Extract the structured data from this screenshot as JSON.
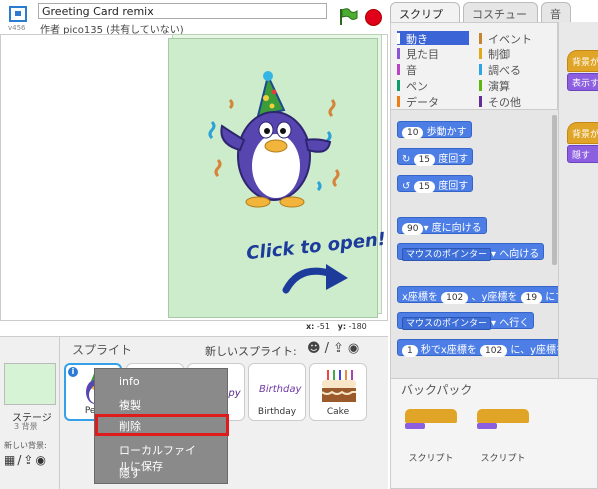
{
  "header": {
    "project_title": "Greeting Card remix",
    "author_line": "作者 pico135 (共有していない)",
    "version": "v456"
  },
  "stage": {
    "card_text": "Click to open!",
    "mouse_x_label": "x:",
    "mouse_x": "-51",
    "mouse_y_label": "y:",
    "mouse_y": "-180"
  },
  "tabs": [
    "スクリプト",
    "コスチューム",
    "音"
  ],
  "categories": {
    "left": [
      {
        "label": "動き",
        "color": "#4a6cd4",
        "selected": true
      },
      {
        "label": "見た目",
        "color": "#8a55d7"
      },
      {
        "label": "音",
        "color": "#bb42c3"
      },
      {
        "label": "ペン",
        "color": "#0e9a6c"
      },
      {
        "label": "データ",
        "color": "#ee7d16"
      }
    ],
    "right": [
      {
        "label": "イベント",
        "color": "#c88330"
      },
      {
        "label": "制御",
        "color": "#e1a91a"
      },
      {
        "label": "調べる",
        "color": "#2ca5e2"
      },
      {
        "label": "演算",
        "color": "#5cb712"
      },
      {
        "label": "その他",
        "color": "#632d99"
      }
    ]
  },
  "blocks": {
    "move_val": "10",
    "move_text": "歩動かす",
    "turn_r_val": "15",
    "turn_r_text": "度回す",
    "turn_l_val": "15",
    "turn_l_text": "度回す",
    "point_val": "90",
    "point_text": "度に向ける",
    "toward_dd": "マウスのポインター",
    "toward_text": "へ向ける",
    "goto_x_text": "x座標を",
    "goto_x_val": "102",
    "goto_y_text": "、y座標を",
    "goto_y_val": "19",
    "goto_end": "にする",
    "goto_dd": "マウスのポインター",
    "goto_text": "へ行く",
    "glide_val": "1",
    "glide_text": "秒でx座標を",
    "glide_x": "102",
    "glide_end": "に、y座標を"
  },
  "scripts": {
    "hat1": "背景が",
    "look1": "表示す",
    "hat2": "背景が",
    "look2": "隠す"
  },
  "sprites": {
    "header": "スプライト",
    "new_sprite_label": "新しいスプライト:",
    "stage_label": "ステージ",
    "stage_sub": "3 背景",
    "new_bg_label": "新しい背景:",
    "tiles": [
      {
        "name": "Pen"
      },
      {
        "name": ""
      },
      {
        "name": ""
      },
      {
        "name": "Birthday",
        "thumb_text": "Birthday"
      },
      {
        "name": "Cake"
      }
    ],
    "happy_text": "ppy"
  },
  "context_menu": {
    "items": [
      "info",
      "複製",
      "削除",
      "ローカルファイルに保存",
      "隠す"
    ]
  },
  "backpack": {
    "title": "バックパック",
    "items": [
      "スクリプト",
      "スクリプト"
    ]
  },
  "colors": {
    "motion": "#4c7ee6",
    "events": "#e0a426",
    "looks": "#8c5fe0",
    "highlight": "#e01b1b"
  }
}
